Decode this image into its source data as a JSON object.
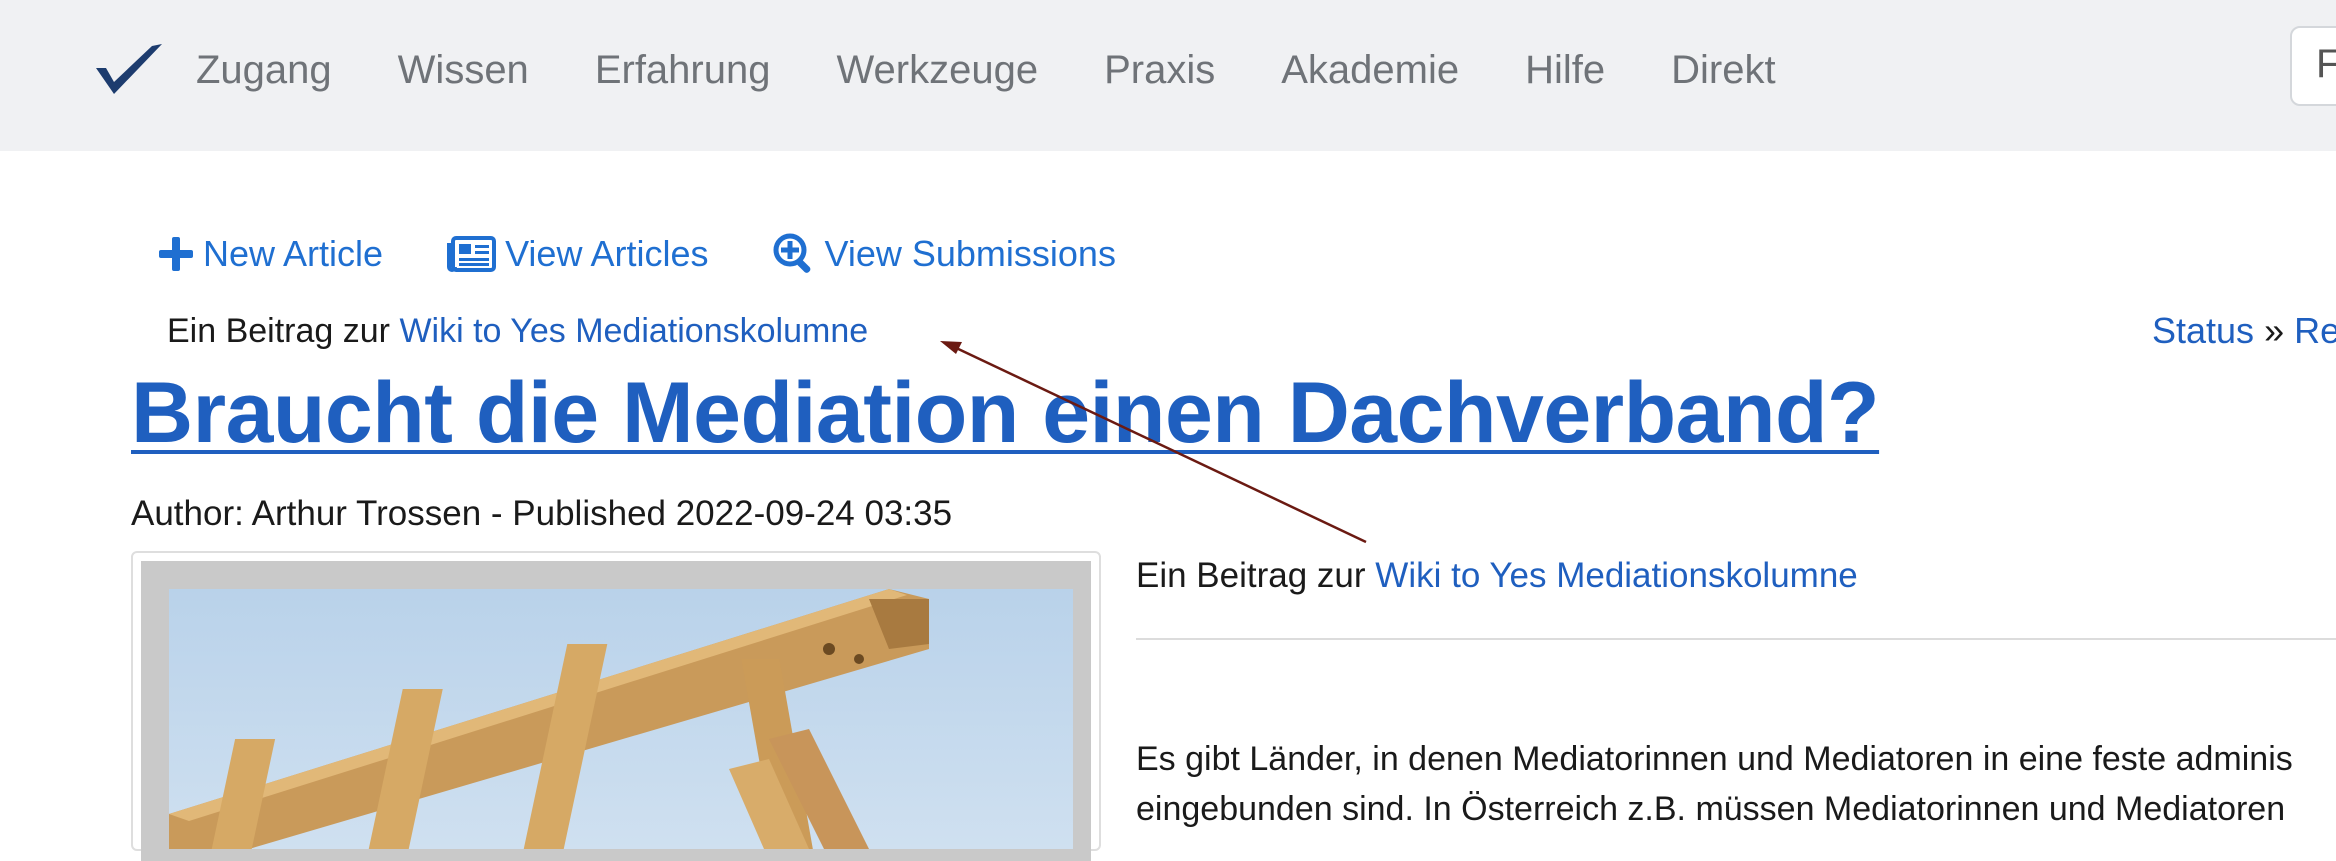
{
  "nav": {
    "items": [
      "Zugang",
      "Wissen",
      "Erfahrung",
      "Werkzeuge",
      "Praxis",
      "Akademie",
      "Hilfe",
      "Direkt"
    ],
    "search_stub_char": "F"
  },
  "actions": {
    "new_article": "New Article",
    "view_articles": "View Articles",
    "view_submissions": "View Submissions"
  },
  "contribution": {
    "prefix": "Ein Beitrag zur ",
    "link": "Wiki to Yes Mediationskolumne"
  },
  "breadcrumb": {
    "status": "Status",
    "separator": "»",
    "next": "Re"
  },
  "article": {
    "title": "Braucht die Mediation einen Dachverband?",
    "byline": "Author: Arthur Trossen - Published 2022-09-24 03:35",
    "body_lines": [
      "Es gibt Länder, in denen Mediatorinnen und Mediatoren in eine feste adminis",
      "eingebunden sind. In Österreich z.B. müssen Mediatorinnen und Mediatoren"
    ]
  },
  "colors": {
    "link": "#1f5fbf",
    "nav_text": "#6f7378",
    "topbar_bg": "#f0f1f3",
    "annotation_arrow": "#6b1a12"
  },
  "icons": {
    "logo": "checkmark-logo-icon",
    "new_article": "plus-icon",
    "view_articles": "newspaper-icon",
    "view_submissions": "magnify-plus-icon"
  }
}
